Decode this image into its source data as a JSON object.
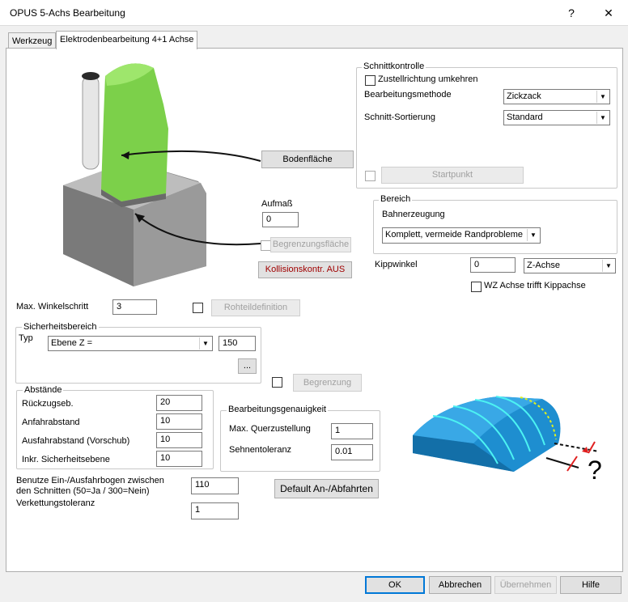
{
  "window": {
    "title": "OPUS 5-Achs Bearbeitung",
    "help_glyph": "?",
    "close_glyph": "✕"
  },
  "tabs": [
    {
      "label": "Werkzeug"
    },
    {
      "label": "Elektrodenbearbeitung 4+1 Achse"
    }
  ],
  "illustration": {
    "bodenflaeche_label": "Bodenfläche",
    "aufmass_label": "Aufmaß",
    "aufmass_value": "0",
    "begrenzungsflaeche_label": "Begrenzungsfläche",
    "kollision_label": "Kollisionskontr. AUS"
  },
  "schnittkontrolle": {
    "title": "Schnittkontrolle",
    "zustellrichtung_label": "Zustellrichtung umkehren",
    "methode_label": "Bearbeitungsmethode",
    "methode_value": "Zickzack",
    "sortierung_label": "Schnitt-Sortierung",
    "sortierung_value": "Standard",
    "startpunkt_label": "Startpunkt"
  },
  "bereich": {
    "title": "Bereich",
    "bahnerzeugung_label": "Bahnerzeugung",
    "bahnerzeugung_value": "Komplett, vermeide Randprobleme"
  },
  "kippwinkel": {
    "label": "Kippwinkel",
    "value": "0",
    "axis_value": "Z-Achse",
    "wz_label": "WZ Achse trifft Kippachse"
  },
  "winkelschritt": {
    "label": "Max. Winkelschritt",
    "value": "3",
    "rohteil_label": "Rohteildefinition"
  },
  "sicherheitsbereich": {
    "title": "Sicherheitsbereich",
    "typ_label": "Typ",
    "typ_value": "Ebene Z =",
    "value": "150",
    "more_label": "...",
    "begrenzung_label": "Begrenzung"
  },
  "abstaende": {
    "title": "Abstände",
    "rows": [
      {
        "label": "Rückzugseb.",
        "value": "20"
      },
      {
        "label": "Anfahrabstand",
        "value": "10"
      },
      {
        "label": "Ausfahrabstand (Vorschub)",
        "value": "10"
      },
      {
        "label": "Inkr. Sicherheitsebene",
        "value": "10"
      }
    ]
  },
  "genauigkeit": {
    "title": "Bearbeitungsgenauigkeit",
    "quer_label": "Max. Querzustellung",
    "quer_value": "1",
    "sehnen_label": "Sehnentoleranz",
    "sehnen_value": "0.01"
  },
  "boegen": {
    "label_line1": "Benutze Ein-/Ausfahrbogen zwischen",
    "label_line2": "den Schnitten (50=Ja / 300=Nein)",
    "value": "110",
    "default_label": "Default An-/Abfahrten"
  },
  "verkettung": {
    "label": "Verkettungstoleranz",
    "value": "1"
  },
  "diagram": {
    "question_mark": "?"
  },
  "footer": {
    "ok": "OK",
    "cancel": "Abbrechen",
    "apply": "Übernehmen",
    "help": "Hilfe"
  },
  "colors": {
    "green_tool": "#7cd04a",
    "blue_part": "#1e8ed0",
    "red_button": "#a00000",
    "focus_blue": "#0078d7"
  }
}
